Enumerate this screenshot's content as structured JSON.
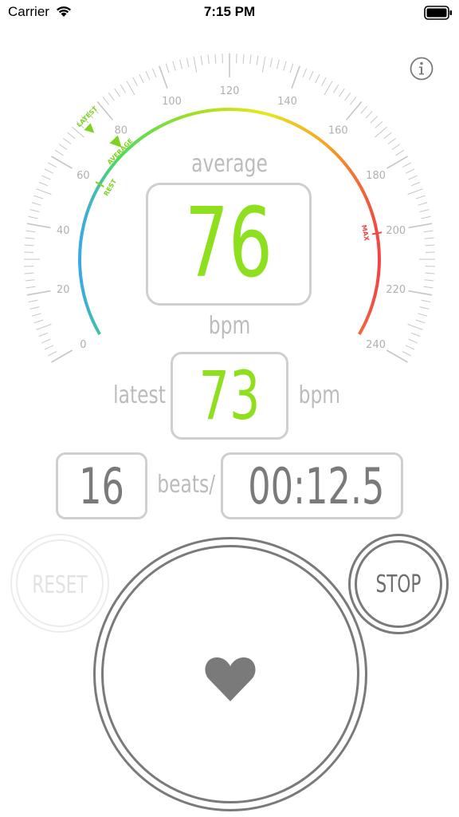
{
  "status_bar": {
    "carrier": "Carrier",
    "time": "7:15 PM"
  },
  "gauge": {
    "min": 0,
    "max": 240,
    "tick_labels": [
      "0",
      "20",
      "40",
      "60",
      "80",
      "100",
      "120",
      "140",
      "160",
      "180",
      "200",
      "220",
      "240"
    ],
    "markers": {
      "latest": {
        "label": "LATEST",
        "value": 73,
        "color": "#7ed321"
      },
      "average": {
        "label": "AVERAGE",
        "value": 76,
        "color": "#7ed321"
      },
      "rest": {
        "label": "REST",
        "value": 60,
        "color": "#7ed321"
      },
      "max": {
        "label": "MAX",
        "value": 200,
        "color": "#f04646"
      }
    },
    "arc_colors": [
      "#3aa8e8",
      "#4cd964",
      "#a6e01e",
      "#e8e61e",
      "#f5a623",
      "#f04646"
    ]
  },
  "readout": {
    "average_label": "average",
    "average_value": "76",
    "average_unit": "bpm",
    "latest_label": "latest",
    "latest_value": "73",
    "latest_unit": "bpm",
    "beats_value": "16",
    "beats_label": "beats/",
    "timer_value": "00:12.5",
    "value_color": "#8ee01e"
  },
  "controls": {
    "reset_label": "RESET",
    "stop_label": "STOP",
    "tap_icon": "heart-icon",
    "info_icon": "info-icon"
  }
}
